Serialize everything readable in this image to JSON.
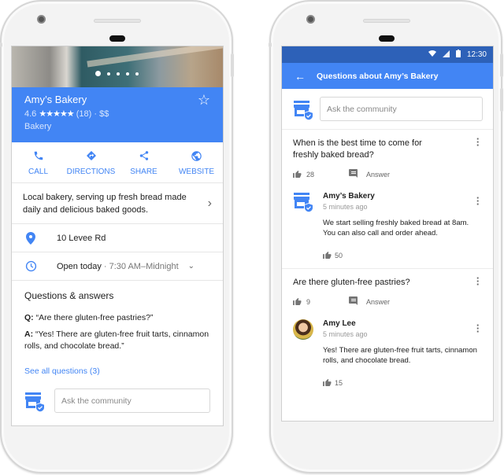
{
  "left_phone": {
    "hero": {
      "image_alt": "bakery interior photo",
      "carousel_pages": 5,
      "carousel_active": 1
    },
    "place": {
      "name": "Amy’s Bakery",
      "rating": "4.6",
      "stars": "★★★★★",
      "review_count": "(18)",
      "price": "· $$",
      "category": "Bakery",
      "save_icon": "star-outline-icon"
    },
    "actions": [
      {
        "label": "CALL",
        "icon": "phone-icon"
      },
      {
        "label": "DIRECTIONS",
        "icon": "directions-icon"
      },
      {
        "label": "SHARE",
        "icon": "share-icon"
      },
      {
        "label": "WEBSITE",
        "icon": "globe-icon"
      }
    ],
    "description": "Local bakery, serving up fresh bread made daily and delicious baked goods.",
    "address": "10 Levee Rd",
    "hours": {
      "status": "Open today",
      "range": "· 7:30 AM–Midnight"
    },
    "qa": {
      "title": "Questions & answers",
      "q_prefix": "Q:",
      "question": "“Are there gluten-free pastries?”",
      "a_prefix": "A:",
      "answer": "“Yes! There are gluten-free fruit tarts, cinnamon rolls, and chocolate bread.”",
      "see_all": "See all questions (3)",
      "ask_placeholder": "Ask the community"
    }
  },
  "right_phone": {
    "status_bar": {
      "time": "12:30",
      "icons": [
        "wifi-icon",
        "signal-icon",
        "battery-icon"
      ]
    },
    "app_bar": {
      "title": "Questions about Amy’s Bakery",
      "back_icon": "arrow-back-icon"
    },
    "ask_placeholder": "Ask the community",
    "questions": [
      {
        "text": "When is the best time to come for freshly baked bread?",
        "likes": "28",
        "answer_label": "Answer",
        "answer": {
          "author": "Amy’s Bakery",
          "time": "5 minutes ago",
          "text": "We start selling freshly baked bread at 8am. You can also call and order ahead.",
          "likes": "50",
          "avatar": "store-verified-icon"
        }
      },
      {
        "text": "Are there gluten-free pastries?",
        "likes": "9",
        "answer_label": "Answer",
        "answer": {
          "author": "Amy Lee",
          "time": "5 minutes ago",
          "text": "Yes! There are gluten-free fruit tarts, cinnamon rolls, and chocolate bread.",
          "likes": "15",
          "avatar": "user-photo"
        }
      }
    ]
  },
  "colors": {
    "primary": "#4285f4",
    "status_bar": "#2d61b8",
    "text": "#212121",
    "muted": "#777777"
  }
}
